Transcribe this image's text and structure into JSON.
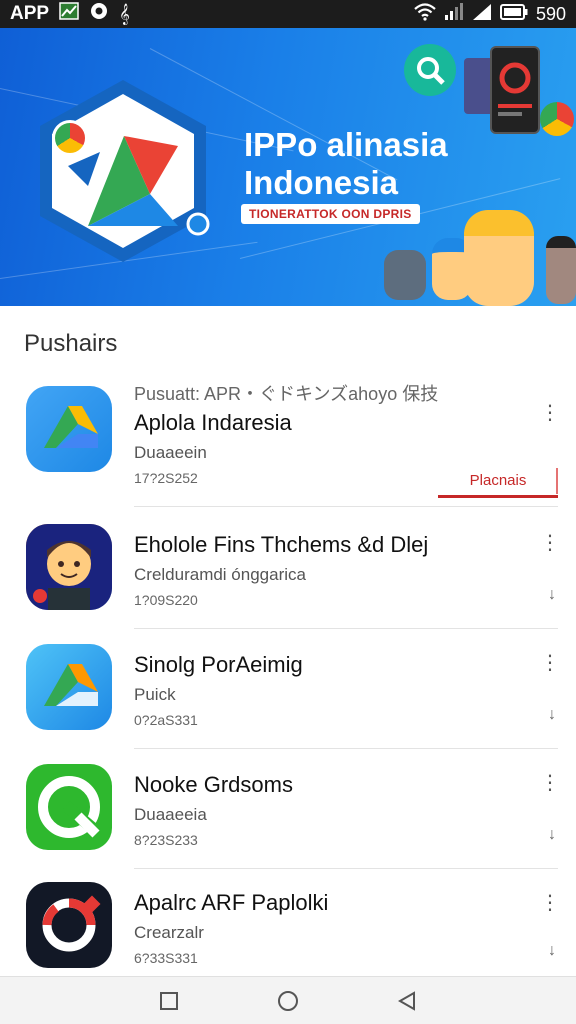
{
  "status_bar": {
    "left_label": "APP",
    "battery": "590",
    "icons": [
      "chart-icon",
      "gear-icon",
      "clef-icon",
      "wifi-icon",
      "signal-icon",
      "signal-icon",
      "battery-icon"
    ]
  },
  "banner": {
    "title_line1": "IPPo alinasia",
    "title_line2": "Indonesia",
    "tagline": "TIONERATTOK OON DPRIS",
    "colors": {
      "bg_start": "#0f5fd6",
      "bg_end": "#2aa0f0",
      "accent": "#c62828"
    }
  },
  "section": {
    "title": "Pushairs"
  },
  "apps": [
    {
      "eyebrow": "Pusuatt: APR・ぐドキンズahoyo 保技",
      "name": "Aplola Indaresia",
      "subtitle": "Duaaeein",
      "meta": "17?2S252",
      "action": "Placnais",
      "icon": "drive-triangle-icon"
    },
    {
      "name": "Eholole Fins Thchems &d Dlej",
      "subtitle": "Crelduramdi ónggarica",
      "meta": "1?09S220",
      "action_icon": "download-icon",
      "icon": "avatar-boy-icon"
    },
    {
      "name": "Sinolg PorAeimig",
      "subtitle": "Puick",
      "meta": "0?2aS331",
      "action_icon": "download-icon",
      "icon": "drive-triangle-icon"
    },
    {
      "name": "Nooke Grdsoms",
      "subtitle": "Duaaeeia",
      "meta": "8?23S233",
      "action_icon": "download-icon",
      "icon": "refresh-lens-icon"
    },
    {
      "name": "Apalrc ARF Paplolki",
      "subtitle": "Crearzalr",
      "meta": "6?33S331",
      "action_icon": "download-icon",
      "icon": "ring-logo-icon"
    }
  ],
  "nav": {
    "icons": [
      "recents-icon",
      "home-icon",
      "back-icon"
    ]
  }
}
